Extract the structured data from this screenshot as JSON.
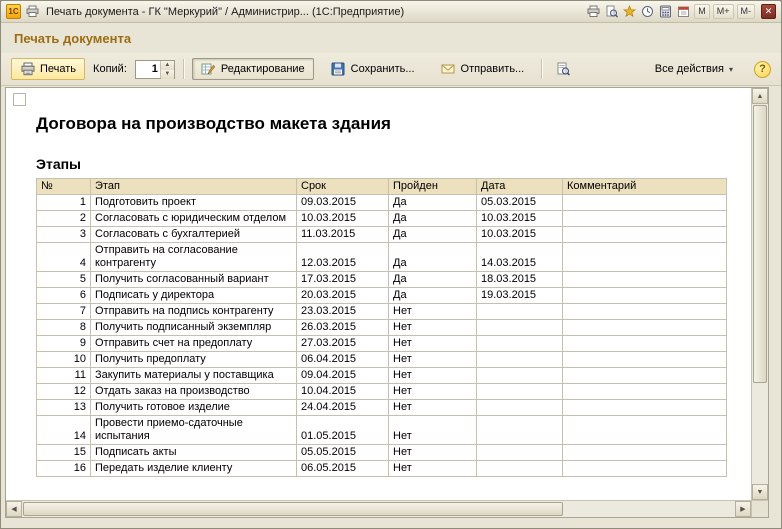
{
  "colors": {
    "page_title_accent": "#9c6d12",
    "chrome_beige": "#e9e5d6",
    "table_header_bg": "#ece0be",
    "grid_line": "#c6c0ae",
    "print_button_bg": "#ffe9a0"
  },
  "titlebar": {
    "logo": "1С",
    "title": "Печать документа - ГК \"Меркурий\" / Администрир...  (1С:Предприятие)",
    "memory_buttons": [
      "М",
      "М+",
      "М-"
    ],
    "close_glyph": "✕"
  },
  "header": {
    "page_title": "Печать документа"
  },
  "toolbar": {
    "print_label": "Печать",
    "copies_label": "Копий:",
    "copies_value": "1",
    "edit_label": "Редактирование",
    "save_label": "Сохранить...",
    "send_label": "Отправить...",
    "all_actions_label": "Все действия",
    "all_actions_arrow": "▾",
    "help_label": "?",
    "spin_up": "▲",
    "spin_down": "▼"
  },
  "scrollbars": {
    "up": "▲",
    "down": "▼",
    "left": "◀",
    "right": "▶"
  },
  "document": {
    "title": "Договора на производство макета здания",
    "section_title": "Этапы",
    "table": {
      "headers": [
        "№",
        "Этап",
        "Срок",
        "Пройден",
        "Дата",
        "Комментарий"
      ],
      "rows": [
        {
          "num": "1",
          "stage": "Подготовить проект",
          "due": "09.03.2015",
          "passed": "Да",
          "date": "05.03.2015",
          "comment": ""
        },
        {
          "num": "2",
          "stage": "Согласовать с юридическим отделом",
          "due": "10.03.2015",
          "passed": "Да",
          "date": "10.03.2015",
          "comment": ""
        },
        {
          "num": "3",
          "stage": "Согласовать с бухгалтерией",
          "due": "11.03.2015",
          "passed": "Да",
          "date": "10.03.2015",
          "comment": ""
        },
        {
          "num": "4",
          "stage": "Отправить на согласование\nконтрагенту",
          "due": "12.03.2015",
          "passed": "Да",
          "date": "14.03.2015",
          "comment": ""
        },
        {
          "num": "5",
          "stage": "Получить согласованный вариант",
          "due": "17.03.2015",
          "passed": "Да",
          "date": "18.03.2015",
          "comment": ""
        },
        {
          "num": "6",
          "stage": "Подписать у директора",
          "due": "20.03.2015",
          "passed": "Да",
          "date": "19.03.2015",
          "comment": ""
        },
        {
          "num": "7",
          "stage": "Отправить на подпись контрагенту",
          "due": "23.03.2015",
          "passed": "Нет",
          "date": "",
          "comment": ""
        },
        {
          "num": "8",
          "stage": "Получить подписанный экземпляр",
          "due": "26.03.2015",
          "passed": "Нет",
          "date": "",
          "comment": ""
        },
        {
          "num": "9",
          "stage": "Отправить счет на предоплату",
          "due": "27.03.2015",
          "passed": "Нет",
          "date": "",
          "comment": ""
        },
        {
          "num": "10",
          "stage": "Получить предоплату",
          "due": "06.04.2015",
          "passed": "Нет",
          "date": "",
          "comment": ""
        },
        {
          "num": "11",
          "stage": "Закупить материалы у поставщика",
          "due": "09.04.2015",
          "passed": "Нет",
          "date": "",
          "comment": ""
        },
        {
          "num": "12",
          "stage": "Отдать заказ на производство",
          "due": "10.04.2015",
          "passed": "Нет",
          "date": "",
          "comment": ""
        },
        {
          "num": "13",
          "stage": "Получить готовое изделие",
          "due": "24.04.2015",
          "passed": "Нет",
          "date": "",
          "comment": ""
        },
        {
          "num": "14",
          "stage": "Провести приемо-сдаточные\nиспытания",
          "due": "01.05.2015",
          "passed": "Нет",
          "date": "",
          "comment": ""
        },
        {
          "num": "15",
          "stage": "Подписать акты",
          "due": "05.05.2015",
          "passed": "Нет",
          "date": "",
          "comment": ""
        },
        {
          "num": "16",
          "stage": "Передать изделие клиенту",
          "due": "06.05.2015",
          "passed": "Нет",
          "date": "",
          "comment": ""
        }
      ]
    }
  }
}
